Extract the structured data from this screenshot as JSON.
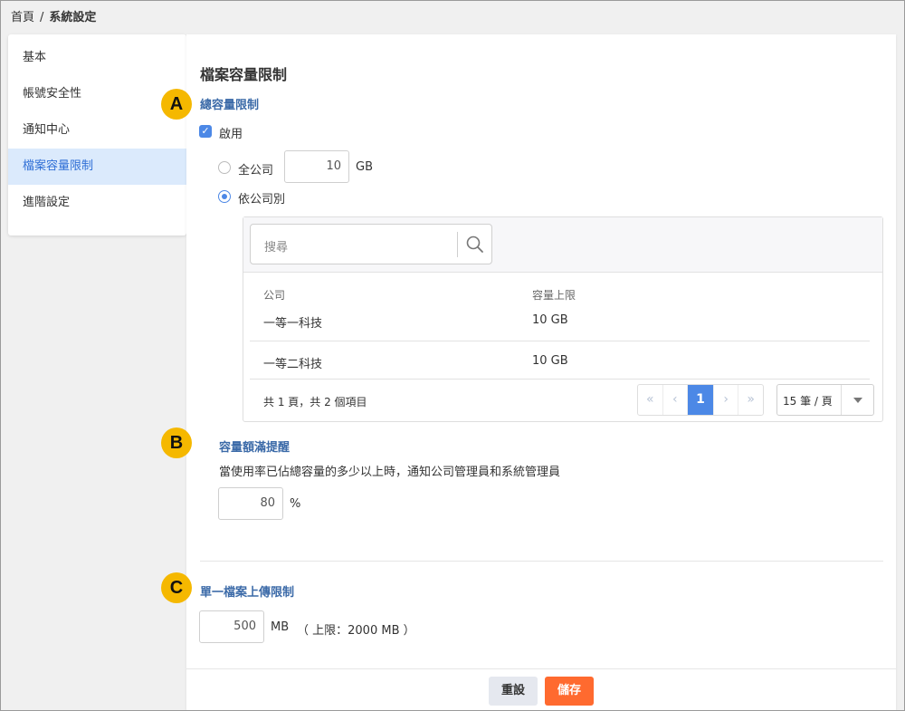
{
  "breadcrumb": {
    "home": "首頁",
    "separator": "/",
    "current": "系統設定"
  },
  "sidebar": {
    "items": [
      {
        "label": "基本"
      },
      {
        "label": "帳號安全性"
      },
      {
        "label": "通知中心"
      },
      {
        "label": "檔案容量限制",
        "active": true
      },
      {
        "label": "進階設定"
      }
    ]
  },
  "main": {
    "title": "檔案容量限制",
    "total": {
      "badge": "A",
      "title": "總容量限制",
      "enable_label": "啟用",
      "enabled": true,
      "all_company_label": "全公司",
      "all_company_value": "10",
      "unit": "GB",
      "by_company_label": "依公司別",
      "selected": "by_company",
      "table": {
        "search_placeholder": "搜尋",
        "columns": [
          "公司",
          "容量上限"
        ],
        "rows": [
          {
            "company": "一等一科技",
            "limit": "10  GB"
          },
          {
            "company": "一等二科技",
            "limit": "10  GB"
          }
        ],
        "summary": "共 1 頁，共 2 個項目",
        "pager": {
          "first": "«",
          "prev": "‹",
          "current": "1",
          "next": "›",
          "last": "»"
        },
        "page_size": "15 筆 / 頁"
      }
    },
    "alert": {
      "badge": "B",
      "title": "容量額滿提醒",
      "description": "當使用率已佔總容量的多少以上時，通知公司管理員和系統管理員",
      "value": "80",
      "unit": "%"
    },
    "single": {
      "badge": "C",
      "title": "單一檔案上傳限制",
      "value": "500",
      "unit": "MB",
      "hint": "（ 上限：2000 MB ）"
    }
  },
  "footer": {
    "reset_label": "重設",
    "save_label": "儲存"
  },
  "colors": {
    "accent": "#4c88e6",
    "save": "#ff6a2f",
    "badge": "#f5b800",
    "section_title": "#3b6aa8"
  }
}
